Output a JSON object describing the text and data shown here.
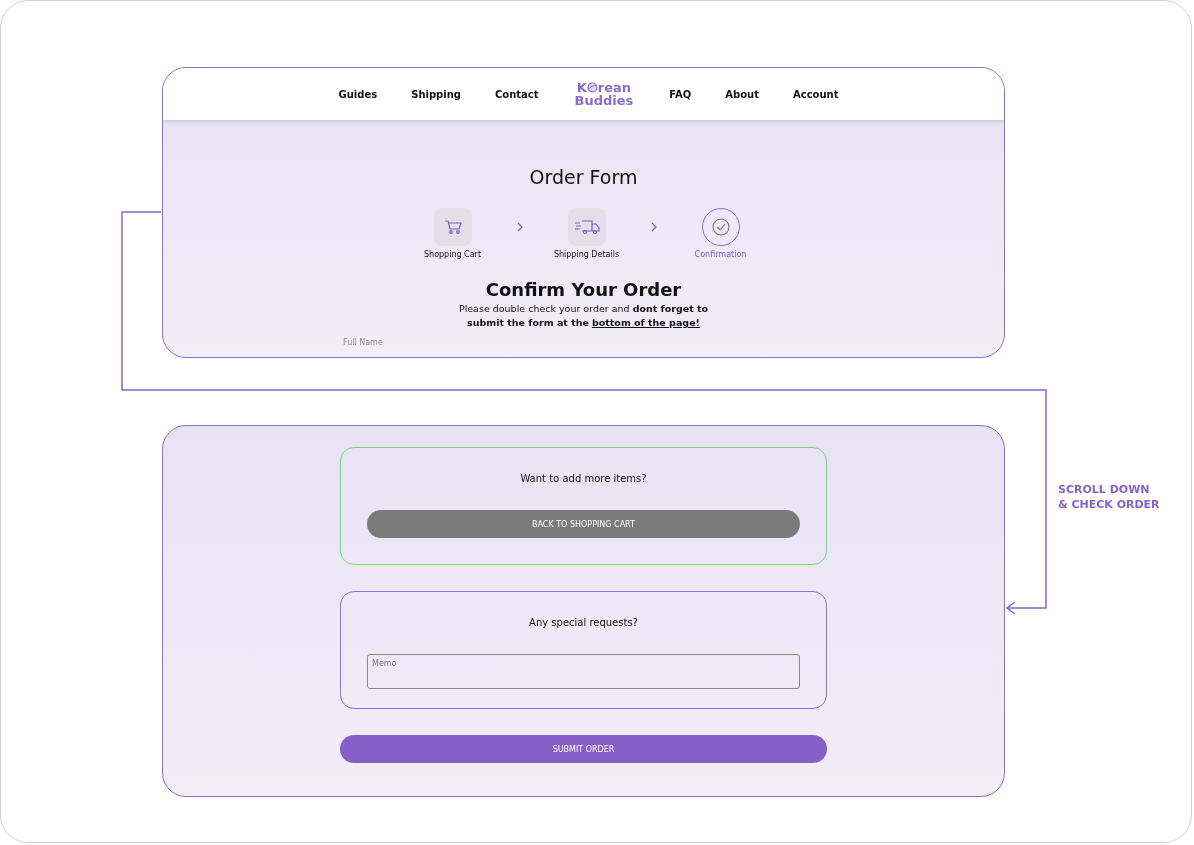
{
  "nav": {
    "links_left": [
      "Guides",
      "Shipping",
      "Contact"
    ],
    "logo": {
      "line1_start": "K",
      "line1_end": "rean",
      "line2": "Buddies"
    },
    "links_right": [
      "FAQ",
      "About",
      "Account"
    ]
  },
  "page_title": "Order Form",
  "steps": [
    {
      "kind": "cart",
      "label": "Shopping Cart",
      "selected": false
    },
    {
      "kind": "truck",
      "label": "Shipping Details",
      "selected": false
    },
    {
      "kind": "check",
      "label": "Confirmation",
      "selected": true
    }
  ],
  "confirm": {
    "title": "Confirm Your Order",
    "text": "Please double check your order and **dont forget to submit the form at the**",
    "link": "bottom of the page!"
  },
  "cut_field_label": "Full Name",
  "more_items": {
    "question": "Want to add more items?",
    "button": "BACK TO SHOPPING CART"
  },
  "requests": {
    "question": "Any special requests?",
    "placeholder": "Memo"
  },
  "submit": "SUBMIT ORDER",
  "annotation": [
    "SCROLL DOWN",
    "& CHECK ORDER"
  ]
}
